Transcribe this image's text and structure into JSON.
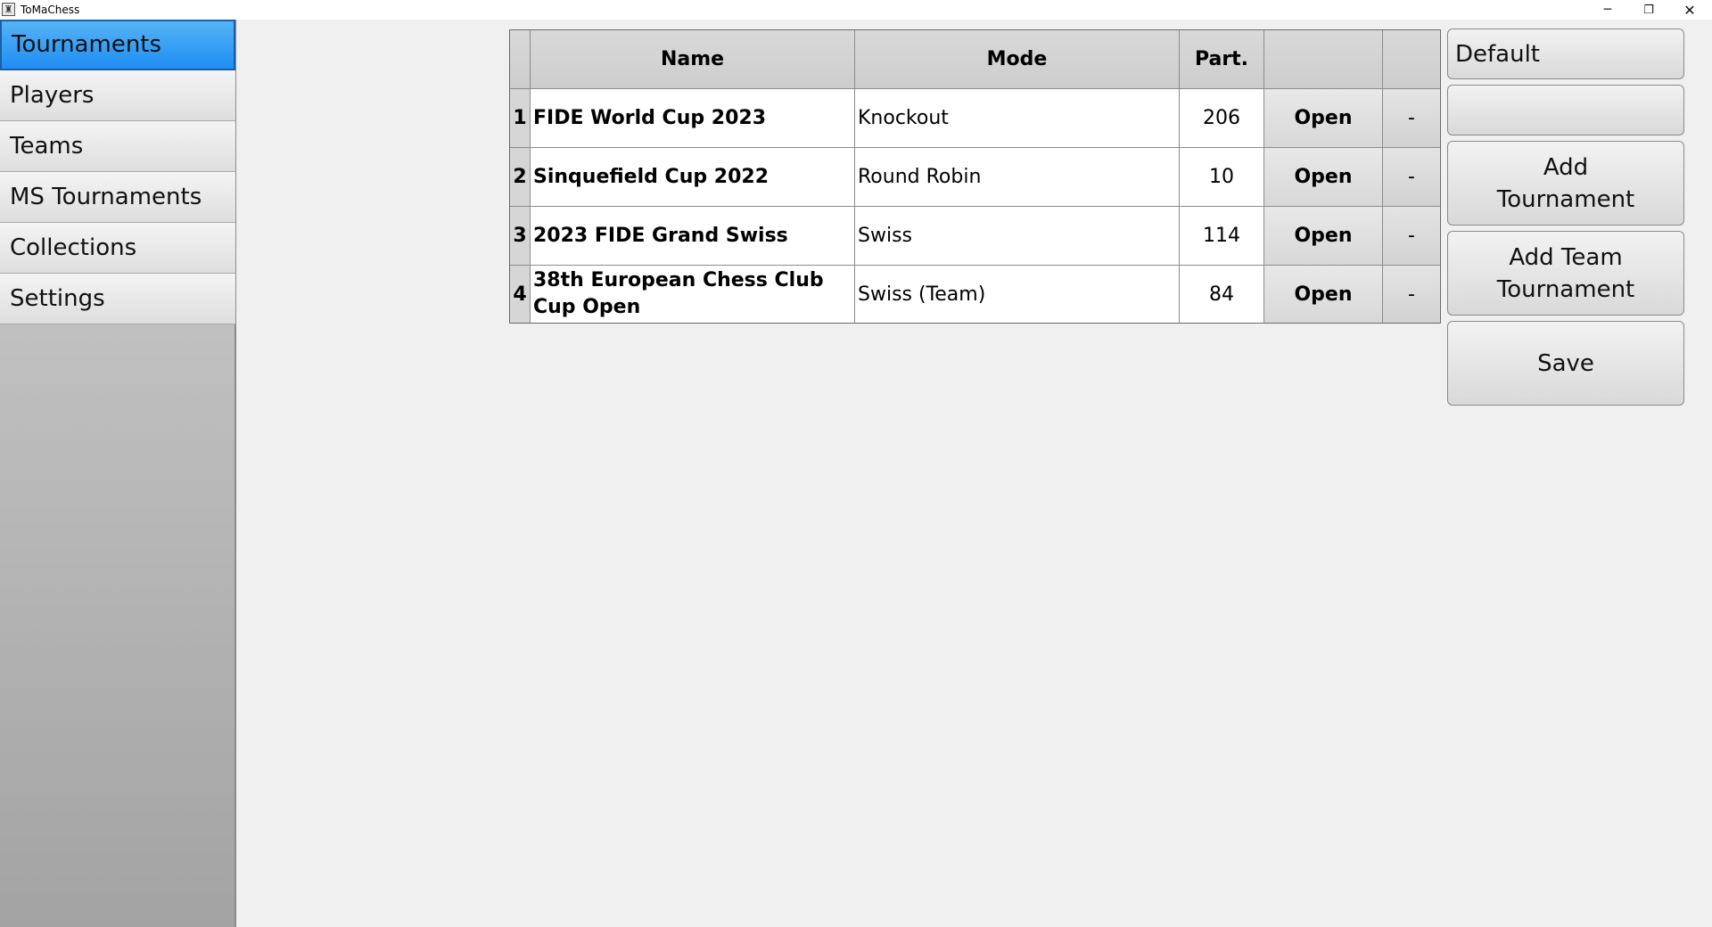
{
  "window": {
    "title": "ToMaChess",
    "app_icon_glyph": "♜",
    "minimize_glyph": "─",
    "restore_glyph": "❐",
    "close_glyph": "✕"
  },
  "sidebar": {
    "items": [
      {
        "label": "Tournaments",
        "active": true
      },
      {
        "label": "Players",
        "active": false
      },
      {
        "label": "Teams",
        "active": false
      },
      {
        "label": "MS Tournaments",
        "active": false
      },
      {
        "label": "Collections",
        "active": false
      },
      {
        "label": "Settings",
        "active": false
      }
    ]
  },
  "table": {
    "headers": {
      "num": "",
      "name": "Name",
      "mode": "Mode",
      "part": "Part.",
      "open": "",
      "delete": ""
    },
    "rows": [
      {
        "num": "1",
        "name": "FIDE World Cup 2023",
        "mode": "Knockout",
        "part": "206",
        "open": "Open",
        "delete": "-"
      },
      {
        "num": "2",
        "name": "Sinquefield Cup 2022",
        "mode": "Round Robin",
        "part": "10",
        "open": "Open",
        "delete": "-"
      },
      {
        "num": "3",
        "name": "2023 FIDE Grand Swiss",
        "mode": "Swiss",
        "part": "114",
        "open": "Open",
        "delete": "-"
      },
      {
        "num": "4",
        "name": "38th European Chess Club Cup Open",
        "mode": "Swiss (Team)",
        "part": "84",
        "open": "Open",
        "delete": "-"
      }
    ]
  },
  "actions": {
    "default_label": "Default",
    "blank_label": "",
    "add_tournament_label": "Add Tournament",
    "add_team_tournament_label": "Add Team Tournament",
    "save_label": "Save"
  },
  "colors": {
    "active_nav": "#2b95f4",
    "background": "#f0f0f0"
  }
}
